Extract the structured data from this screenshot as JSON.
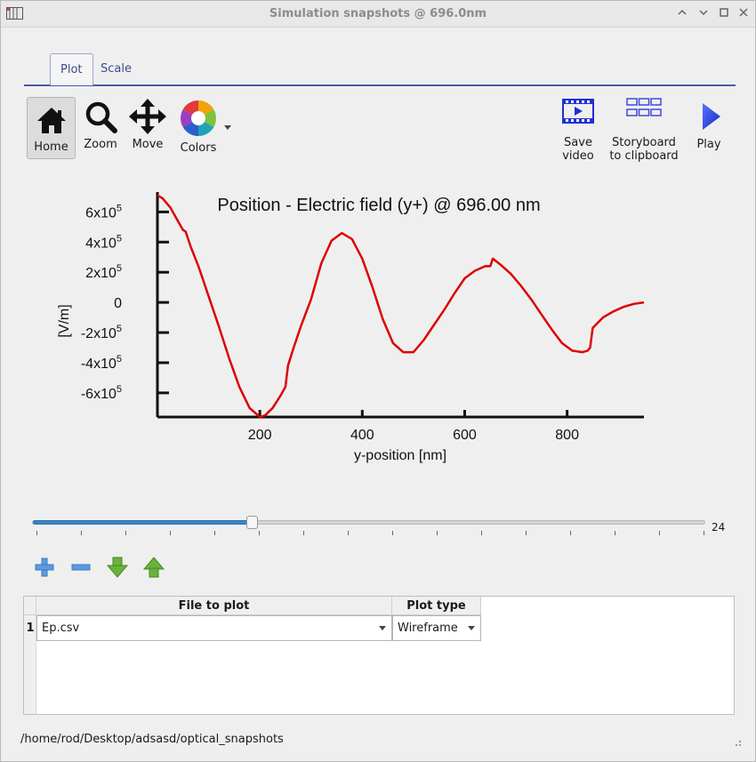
{
  "window": {
    "title": "Simulation snapshots @ 696.0nm",
    "controls": [
      "chevron-up",
      "close-x",
      "maximize-square",
      "close"
    ]
  },
  "tabs": [
    {
      "label": "Plot",
      "active": true
    },
    {
      "label": "Scale",
      "active": false
    }
  ],
  "toolbar": {
    "home_label": "Home",
    "zoom_label": "Zoom",
    "move_label": "Move",
    "colors_label": "Colors",
    "save_video_line1": "Save",
    "save_video_line2": "video",
    "storyboard_line1": "Storyboard",
    "storyboard_line2": "to clipboard",
    "play_label": "Play"
  },
  "chart_data": {
    "type": "line",
    "title": "Position - Electric field (y+) @ 696.00 nm",
    "xlabel": "y-position [nm]",
    "ylabel": "[V/m]",
    "xlim": [
      0,
      950
    ],
    "ylim": [
      -760000,
      720000
    ],
    "x_ticks": [
      "200",
      "400",
      "600",
      "800"
    ],
    "x_tick_values": [
      200,
      400,
      600,
      800
    ],
    "y_ticks": [
      "6x10",
      "4x10",
      "2x10",
      "0",
      "-2x10",
      "-4x10",
      "-6x10"
    ],
    "y_tick_exponents": [
      "5",
      "5",
      "5",
      "",
      "5",
      "5",
      "5"
    ],
    "y_tick_values": [
      600000,
      400000,
      200000,
      0,
      -200000,
      -400000,
      -600000
    ],
    "series": [
      {
        "color": "#dd0000",
        "x": [
          0,
          10,
          25,
          40,
          50,
          55,
          65,
          80,
          100,
          120,
          140,
          160,
          180,
          200,
          210,
          225,
          240,
          250,
          255,
          265,
          280,
          300,
          320,
          340,
          360,
          380,
          400,
          420,
          440,
          460,
          480,
          500,
          520,
          540,
          560,
          580,
          600,
          620,
          640,
          650,
          655,
          670,
          690,
          710,
          730,
          750,
          770,
          790,
          810,
          830,
          840,
          845,
          850,
          870,
          890,
          910,
          930,
          950
        ],
        "y": [
          710000,
          690000,
          630000,
          540000,
          480000,
          470000,
          370000,
          240000,
          40000,
          -160000,
          -370000,
          -560000,
          -700000,
          -760000,
          -750000,
          -700000,
          -620000,
          -560000,
          -420000,
          -310000,
          -160000,
          20000,
          260000,
          410000,
          460000,
          420000,
          290000,
          100000,
          -110000,
          -270000,
          -330000,
          -330000,
          -250000,
          -150000,
          -50000,
          60000,
          160000,
          210000,
          240000,
          240000,
          290000,
          250000,
          190000,
          110000,
          20000,
          -80000,
          -180000,
          -270000,
          -320000,
          -330000,
          -320000,
          -300000,
          -170000,
          -100000,
          -60000,
          -30000,
          -10000,
          0
        ]
      }
    ],
    "grid": false
  },
  "slider": {
    "value": "24",
    "fraction": 0.325
  },
  "list_buttons": [
    "add-icon",
    "remove-icon",
    "move-down-icon",
    "move-up-icon"
  ],
  "table": {
    "headers": [
      "File to plot",
      "Plot type"
    ],
    "rows": [
      {
        "num": "1",
        "file": "Ep.csv",
        "plot_type": "Wireframe"
      }
    ]
  },
  "status": {
    "path": "/home/rod/Desktop/adsasd/optical_snapshots"
  }
}
